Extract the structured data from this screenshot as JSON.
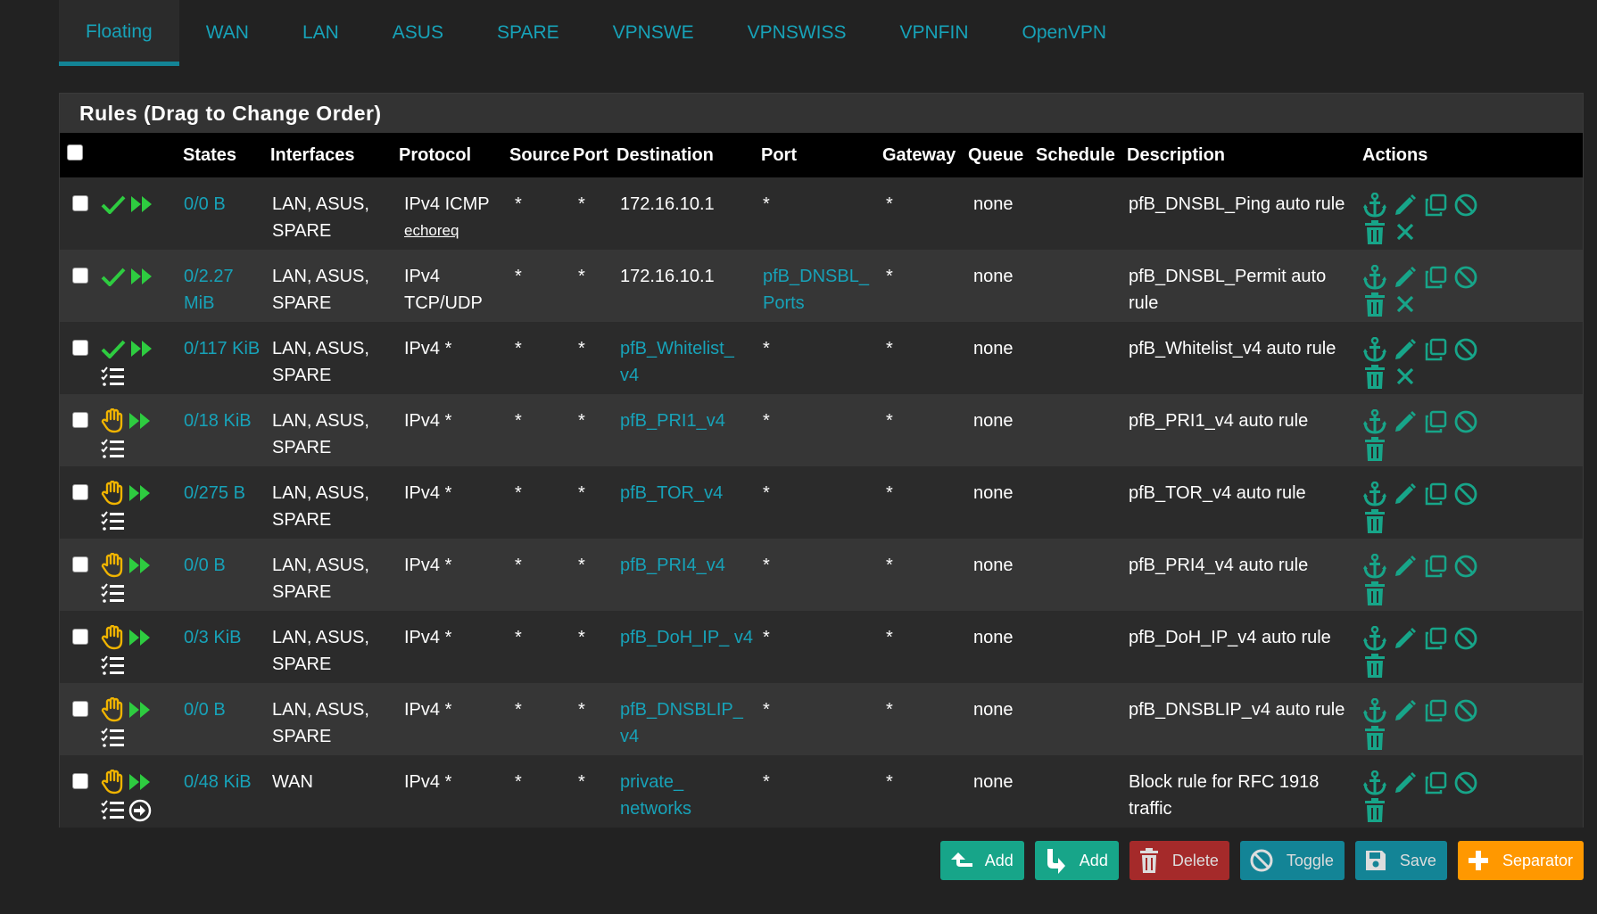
{
  "tabs": [
    "Floating",
    "WAN",
    "LAN",
    "ASUS",
    "SPARE",
    "VPNSWE",
    "VPNSWISS",
    "VPNFIN",
    "OpenVPN"
  ],
  "active_tab": "Floating",
  "panel": {
    "title": "Rules (Drag to Change Order)"
  },
  "table": {
    "headers": [
      "States",
      "Interfaces",
      "Protocol",
      "Source",
      "Port",
      "Destination",
      "Port",
      "Gateway",
      "Queue",
      "Schedule",
      "Description",
      "Actions"
    ],
    "rows": [
      {
        "status": "pass",
        "states": "0/0 B",
        "interfaces": "LAN, ASUS, SPARE",
        "protocol": "IPv4 ICMP",
        "protocol_sub": "echoreq",
        "source": "*",
        "source_port": "*",
        "destination": "172.16.10.1",
        "destination_link": false,
        "dest_port": "*",
        "dest_port_link": false,
        "gateway": "*",
        "queue": "none",
        "schedule": "",
        "description": "pfB_DNSBL_Ping auto rule",
        "log": false,
        "log_arrow": false
      },
      {
        "status": "pass",
        "states": "0/2.27 MiB",
        "interfaces": "LAN, ASUS, SPARE",
        "protocol": "IPv4 TCP/UDP",
        "protocol_sub": "",
        "source": "*",
        "source_port": "*",
        "destination": "172.16.10.1",
        "destination_link": false,
        "dest_port": "pfB_DNSBL_ Ports",
        "dest_port_link": true,
        "gateway": "*",
        "queue": "none",
        "schedule": "",
        "description": "pfB_DNSBL_Permit auto rule",
        "log": false,
        "log_arrow": false
      },
      {
        "status": "pass",
        "states": "0/117 KiB",
        "interfaces": "LAN, ASUS, SPARE",
        "protocol": "IPv4 *",
        "protocol_sub": "",
        "source": "*",
        "source_port": "*",
        "destination": "pfB_Whitelist_ v4",
        "destination_link": true,
        "dest_port": "*",
        "dest_port_link": false,
        "gateway": "*",
        "queue": "none",
        "schedule": "",
        "description": "pfB_Whitelist_v4 auto rule",
        "log": true,
        "log_arrow": false
      },
      {
        "status": "block",
        "states": "0/18 KiB",
        "interfaces": "LAN, ASUS, SPARE",
        "protocol": "IPv4 *",
        "protocol_sub": "",
        "source": "*",
        "source_port": "*",
        "destination": "pfB_PRI1_v4",
        "destination_link": true,
        "dest_port": "*",
        "dest_port_link": false,
        "gateway": "*",
        "queue": "none",
        "schedule": "",
        "description": "pfB_PRI1_v4 auto rule",
        "log": true,
        "log_arrow": false
      },
      {
        "status": "block",
        "states": "0/275 B",
        "interfaces": "LAN, ASUS, SPARE",
        "protocol": "IPv4 *",
        "protocol_sub": "",
        "source": "*",
        "source_port": "*",
        "destination": "pfB_TOR_v4",
        "destination_link": true,
        "dest_port": "*",
        "dest_port_link": false,
        "gateway": "*",
        "queue": "none",
        "schedule": "",
        "description": "pfB_TOR_v4 auto rule",
        "log": true,
        "log_arrow": false
      },
      {
        "status": "block",
        "states": "0/0 B",
        "interfaces": "LAN, ASUS, SPARE",
        "protocol": "IPv4 *",
        "protocol_sub": "",
        "source": "*",
        "source_port": "*",
        "destination": "pfB_PRI4_v4",
        "destination_link": true,
        "dest_port": "*",
        "dest_port_link": false,
        "gateway": "*",
        "queue": "none",
        "schedule": "",
        "description": "pfB_PRI4_v4 auto rule",
        "log": true,
        "log_arrow": false
      },
      {
        "status": "block",
        "states": "0/3 KiB",
        "interfaces": "LAN, ASUS, SPARE",
        "protocol": "IPv4 *",
        "protocol_sub": "",
        "source": "*",
        "source_port": "*",
        "destination": "pfB_DoH_IP_ v4",
        "destination_link": true,
        "dest_port": "*",
        "dest_port_link": false,
        "gateway": "*",
        "queue": "none",
        "schedule": "",
        "description": "pfB_DoH_IP_v4 auto rule",
        "log": true,
        "log_arrow": false
      },
      {
        "status": "block",
        "states": "0/0 B",
        "interfaces": "LAN, ASUS, SPARE",
        "protocol": "IPv4 *",
        "protocol_sub": "",
        "source": "*",
        "source_port": "*",
        "destination": "pfB_DNSBLIP_ v4",
        "destination_link": true,
        "dest_port": "*",
        "dest_port_link": false,
        "gateway": "*",
        "queue": "none",
        "schedule": "",
        "description": "pfB_DNSBLIP_v4 auto rule",
        "log": true,
        "log_arrow": false
      },
      {
        "status": "block",
        "states": "0/48 KiB",
        "interfaces": "WAN",
        "protocol": "IPv4 *",
        "protocol_sub": "",
        "source": "*",
        "source_port": "*",
        "destination": "private_ networks",
        "destination_link": true,
        "dest_port": "*",
        "dest_port_link": false,
        "gateway": "*",
        "queue": "none",
        "schedule": "",
        "description": "Block rule for RFC 1918 traffic",
        "log": true,
        "log_arrow": true
      }
    ]
  },
  "buttons": {
    "add_top": "Add",
    "add_bottom": "Add",
    "delete": "Delete",
    "toggle": "Toggle",
    "save": "Save",
    "separator": "Separator"
  },
  "colors": {
    "accent": "#17a2b8",
    "pass": "#2ecc40",
    "block": "#f0b400",
    "action_icon": "#17a589",
    "warning": "#ff9800",
    "danger": "#a52a2a"
  }
}
